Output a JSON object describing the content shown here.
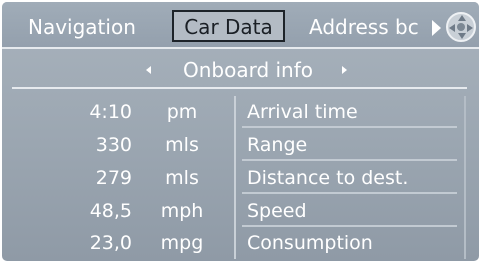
{
  "menu": {
    "items": [
      "Navigation",
      "Car Data",
      "Address bc"
    ],
    "selected": "Car Data"
  },
  "icons": {
    "scroll": "right-triangle-icon",
    "controller": "controller-dpad-icon"
  },
  "subheader": {
    "title": "Onboard info",
    "left_icon": "left-arrow-icon",
    "right_icon": "right-arrow-icon"
  },
  "table": {
    "rows": [
      {
        "value": "4:10",
        "unit": "pm",
        "label": "Arrival time"
      },
      {
        "value": "330",
        "unit": "mls",
        "label": "Range"
      },
      {
        "value": "279",
        "unit": "mls",
        "label": "Distance to dest."
      },
      {
        "value": "48,5",
        "unit": "mph",
        "label": "Speed"
      },
      {
        "value": "23,0",
        "unit": "mpg",
        "label": "Consumption"
      }
    ]
  },
  "colors": {
    "background": "#9ba6b1",
    "text": "#ffffff",
    "selected_text": "#1a1f25"
  }
}
